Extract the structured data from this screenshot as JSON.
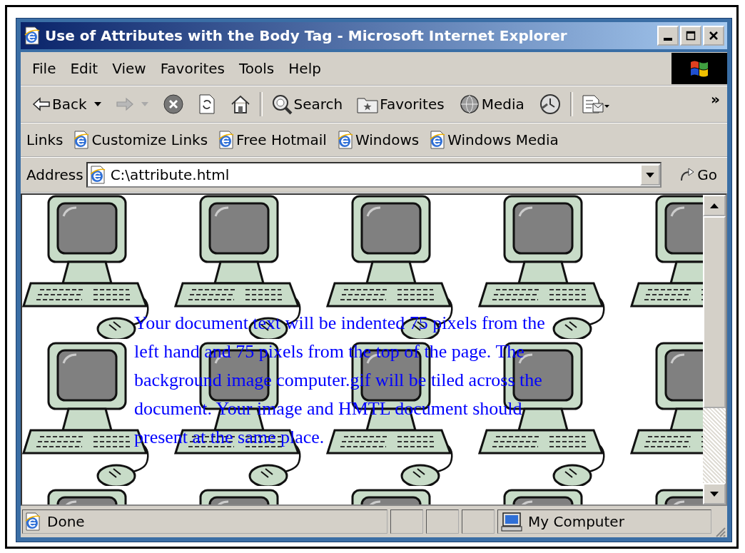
{
  "window": {
    "title": "Use of Attributes with the Body Tag - Microsoft Internet Explorer"
  },
  "menu": [
    "File",
    "Edit",
    "View",
    "Favorites",
    "Tools",
    "Help"
  ],
  "toolbar": [
    {
      "kind": "back",
      "label": "Back",
      "disabled": false
    },
    {
      "kind": "forward",
      "disabled": true
    },
    {
      "kind": "stop"
    },
    {
      "kind": "refresh"
    },
    {
      "kind": "home"
    },
    {
      "kind": "search",
      "label": "Search"
    },
    {
      "kind": "favorites",
      "label": "Favorites"
    },
    {
      "kind": "media",
      "label": "Media"
    },
    {
      "kind": "history"
    },
    {
      "kind": "mail"
    }
  ],
  "toolbar_overflow": "»",
  "links": {
    "label": "Links",
    "items": [
      "Customize Links",
      "Free Hotmail",
      "Windows",
      "Windows Media"
    ]
  },
  "address": {
    "label": "Address",
    "value": "C:\\attribute.html",
    "go": "Go"
  },
  "page": {
    "text": "Your document text will be indented 75 pixels from the left hand and 75 pixels from the top of the page. The background image computer.gif will be tiled across the document. Your image and HMTL document should present at the same place."
  },
  "status_bar": {
    "text": "Done",
    "zone": "My Computer"
  }
}
